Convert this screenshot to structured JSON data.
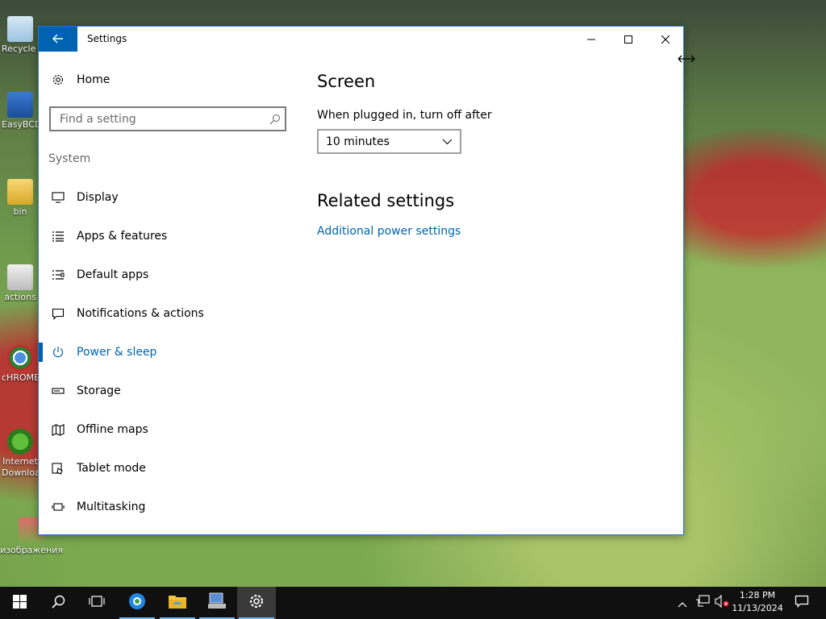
{
  "desktop": {
    "icons": [
      {
        "label": "Recycle Bin"
      },
      {
        "label": "EasyBCD"
      },
      {
        "label": "bin"
      },
      {
        "label": "actions"
      },
      {
        "label": "cHROME"
      },
      {
        "label": "Internet Download"
      },
      {
        "label": "изображения"
      }
    ]
  },
  "window": {
    "title": "Settings",
    "back_icon": "arrow-left-icon"
  },
  "sidebar": {
    "home_label": "Home",
    "search_placeholder": "Find a setting",
    "section": "System",
    "items": [
      {
        "label": "Display",
        "icon": "monitor-icon"
      },
      {
        "label": "Apps & features",
        "icon": "list-icon"
      },
      {
        "label": "Default apps",
        "icon": "default-apps-icon"
      },
      {
        "label": "Notifications & actions",
        "icon": "notification-icon"
      },
      {
        "label": "Power & sleep",
        "icon": "power-icon",
        "selected": true
      },
      {
        "label": "Storage",
        "icon": "storage-icon"
      },
      {
        "label": "Offline maps",
        "icon": "map-icon"
      },
      {
        "label": "Tablet mode",
        "icon": "tablet-icon"
      },
      {
        "label": "Multitasking",
        "icon": "multitasking-icon"
      }
    ]
  },
  "content": {
    "heading": "Screen",
    "plugged_label": "When plugged in, turn off after",
    "plugged_value": "10 minutes",
    "related_heading": "Related settings",
    "link": "Additional power settings"
  },
  "taskbar": {
    "clock_time": "1:28 PM",
    "clock_date": "11/13/2024"
  },
  "colors": {
    "accent": "#0063b1",
    "taskbar": "#101010"
  }
}
